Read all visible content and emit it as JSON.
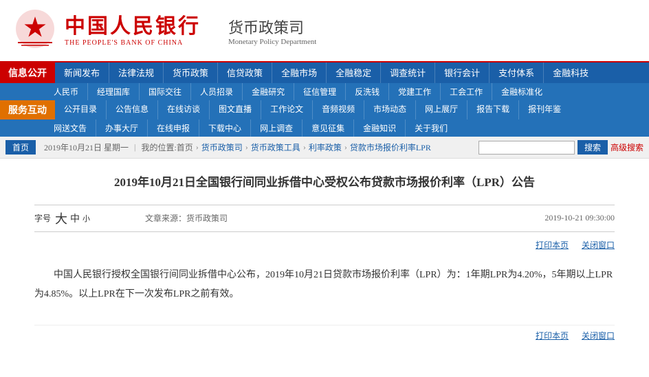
{
  "header": {
    "logo_cn": "中国人民银行",
    "logo_en": "THE PEOPLE'S BANK OF CHINA",
    "dept_cn": "货币政策司",
    "dept_en": "Monetary Policy Department"
  },
  "nav": {
    "label1": "信息公开",
    "label2": "服务互动",
    "row1": [
      "新闻发布",
      "法律法规",
      "货币政策",
      "信贷政策",
      "全融市场",
      "全融稳定",
      "调查统计",
      "银行会计",
      "支付体系",
      "金融科技"
    ],
    "row2": [
      "人民币",
      "经理国库",
      "国际交往",
      "人员招录",
      "金融研究",
      "征信管理",
      "反洗钱",
      "党建工作",
      "工会工作",
      "金融标准化"
    ],
    "row3": [
      "公开目录",
      "公告信息",
      "在线访谈",
      "图文直播",
      "工作论文",
      "音频视频",
      "市场动态",
      "网上展厅",
      "报告下载",
      "报刊年鉴"
    ],
    "row4": [
      "网送文告",
      "办事大厅",
      "在线申报",
      "下载中心",
      "网上调查",
      "意见征集",
      "金融知识",
      "关于我们"
    ]
  },
  "breadcrumb": {
    "home": "首页",
    "path": [
      "我的位置:首页",
      "货币政策司",
      "货币政策工具",
      "利率政策",
      "贷款市场报价利率LPR"
    ]
  },
  "search": {
    "placeholder": "",
    "btn": "搜索",
    "advanced": "高级搜索"
  },
  "article": {
    "title": "2019年10月21日全国银行间同业拆借中心受权公布贷款市场报价利率（LPR）公告",
    "font_label": "字号",
    "font_large": "大",
    "font_medium": "中",
    "font_small": "小",
    "source_label": "文章来源：",
    "source": "货币政策司",
    "date": "2019-10-21 09:30:00",
    "print": "打印本页",
    "close": "关闭窗口",
    "body": "　　中国人民银行授权全国银行间同业拆借中心公布，2019年10月21日贷款市场报价利率（LPR）为：1年期LPR为4.20%，5年期以上LPR为4.85%。以上LPR在下一次发布LPR之前有效。",
    "print2": "打印本页",
    "close2": "关闭窗口"
  }
}
